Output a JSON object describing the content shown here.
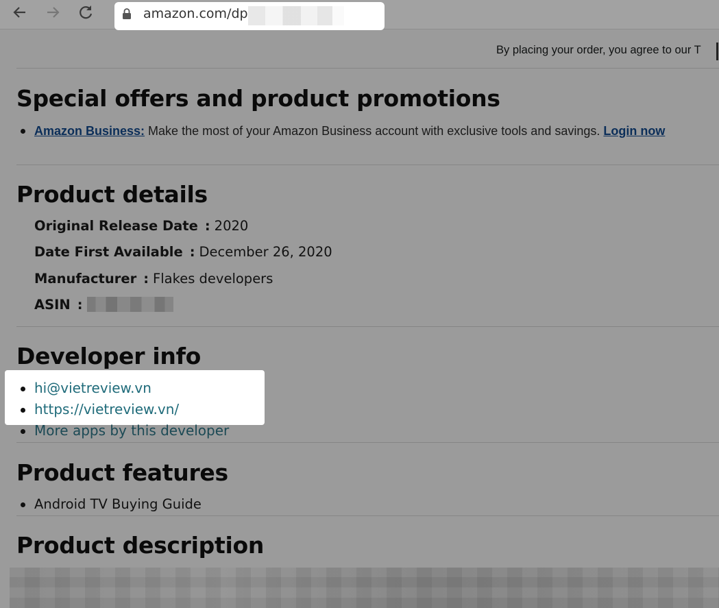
{
  "browser": {
    "url": "amazon.com/dp"
  },
  "page": {
    "agree_text": "By placing your order, you agree to our T",
    "offers": {
      "title": "Special offers and product promotions",
      "item_link": "Amazon Business:",
      "item_text": " Make the most of your Amazon Business account with exclusive tools and savings. ",
      "login_link": "Login now"
    },
    "details": {
      "title": "Product details",
      "rows": [
        {
          "key": "Original Release Date",
          "sep": ":",
          "value": "2020"
        },
        {
          "key": "Date First Available",
          "sep": ":",
          "value": "December 26, 2020"
        },
        {
          "key": "Manufacturer",
          "sep": ":",
          "value": "Flakes developers"
        },
        {
          "key": "ASIN",
          "sep": ":",
          "value": ""
        }
      ]
    },
    "developer": {
      "title": "Developer info",
      "email": "hi@vietreview.vn",
      "website": "https://vietreview.vn/",
      "more_apps": "More apps by this developer"
    },
    "features": {
      "title": "Product features",
      "items": [
        "Android TV Buying Guide"
      ]
    },
    "description": {
      "title": "Product description"
    }
  },
  "colors": {
    "overlay_bg": "#9b9b9b",
    "link_blue": "#0b2e59",
    "link_teal": "#1f6b7a"
  }
}
